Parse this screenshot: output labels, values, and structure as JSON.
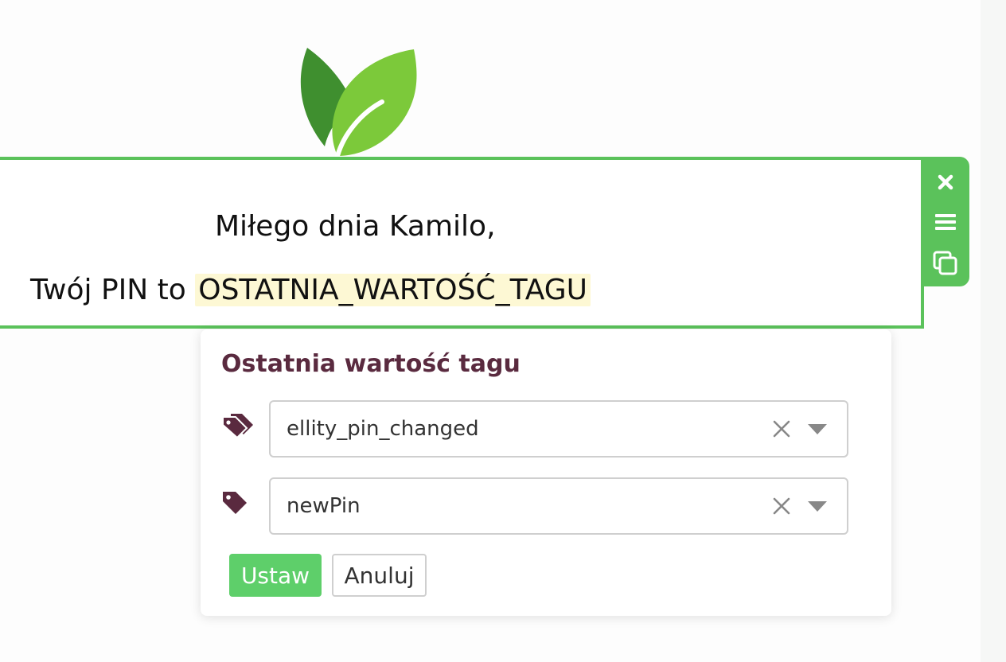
{
  "editor": {
    "greeting": "Miłego dnia Kamilo,",
    "pin_prefix": "Twój PIN to ",
    "pin_tag": "OSTATNIA_WARTOŚĆ_TAGU"
  },
  "toolbar": {
    "close_icon": "close-icon",
    "menu_icon": "hamburger-menu-icon",
    "copy_icon": "copy-icon"
  },
  "popup": {
    "title": "Ostatnia wartość tagu",
    "fields": [
      {
        "icon": "tags-icon",
        "value": "ellity_pin_changed"
      },
      {
        "icon": "tag-icon",
        "value": "newPin"
      }
    ],
    "set_label": "Ustaw",
    "cancel_label": "Anuluj"
  },
  "colors": {
    "accent_green": "#5bc25b",
    "button_green": "#5ecf6a",
    "title_maroon": "#5a2a3f",
    "tag_highlight": "#fdf8d4",
    "leaf_dark": "#3f8f2f",
    "leaf_light": "#7cc93a"
  }
}
